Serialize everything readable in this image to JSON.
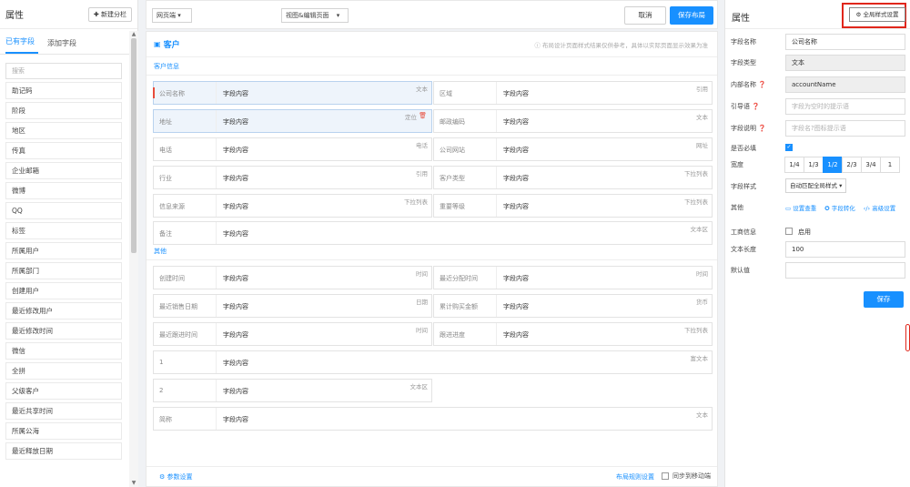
{
  "left": {
    "title": "属性",
    "new_group": "✚ 新建分栏",
    "tabs": [
      "已有字段",
      "添加字段"
    ],
    "search_placeholder": "搜索",
    "fields": [
      "助记码",
      "阶段",
      "地区",
      "传真",
      "企业邮箱",
      "微博",
      "QQ",
      "标签",
      "所属用户",
      "所属部门",
      "创建用户",
      "最近修改用户",
      "最近修改时间",
      "微信",
      "全拼",
      "父级客户",
      "最近共享时间",
      "所属公海",
      "最近释放日期"
    ]
  },
  "topbar": {
    "device": "网页端",
    "view": "视图&编辑页面",
    "cancel": "取消",
    "save_layout": "保存布局"
  },
  "canvas": {
    "title": "客户",
    "hint": "布局设计页面样式结果仅供参考，具体以实际页面显示效果为准",
    "sections": [
      {
        "title": "客户信息"
      },
      {
        "title": "其他"
      }
    ],
    "cells1": [
      {
        "label": "公司名称",
        "value": "字段内容",
        "type": "文本"
      },
      {
        "label": "区域",
        "value": "字段内容",
        "type": "引用"
      },
      {
        "label": "地址",
        "value": "字段内容",
        "type": "定位"
      },
      {
        "label": "邮政编码",
        "value": "字段内容",
        "type": "文本"
      },
      {
        "label": "电话",
        "value": "字段内容",
        "type": "电话"
      },
      {
        "label": "公司网站",
        "value": "字段内容",
        "type": "网址"
      },
      {
        "label": "行业",
        "value": "字段内容",
        "type": "引用"
      },
      {
        "label": "客户类型",
        "value": "字段内容",
        "type": "下拉列表"
      },
      {
        "label": "信息来源",
        "value": "字段内容",
        "type": "下拉列表"
      },
      {
        "label": "重要等级",
        "value": "字段内容",
        "type": "下拉列表"
      },
      {
        "label": "备注",
        "value": "字段内容",
        "type": "文本区"
      }
    ],
    "cells2": [
      {
        "label": "创建时间",
        "value": "字段内容",
        "type": "时间"
      },
      {
        "label": "最近分配时间",
        "value": "字段内容",
        "type": "时间"
      },
      {
        "label": "最近销售日期",
        "value": "字段内容",
        "type": "日期"
      },
      {
        "label": "累计购买金额",
        "value": "字段内容",
        "type": "货币"
      },
      {
        "label": "最近跟进时间",
        "value": "字段内容",
        "type": "时间"
      },
      {
        "label": "跟进进度",
        "value": "字段内容",
        "type": "下拉列表"
      },
      {
        "label": "1",
        "value": "字段内容",
        "type": "富文本"
      },
      {
        "label": "2",
        "value": "字段内容",
        "type": "文本区"
      },
      {
        "label": "简称",
        "value": "字段内容",
        "type": "文本"
      }
    ],
    "foot_left": "⚙ 参数设置",
    "foot_right": "布局规则设置",
    "foot_sync": "同步到移动端"
  },
  "right": {
    "title": "属性",
    "global_btn": "⚙ 全局样式设置",
    "rows": {
      "name_k": "字段名称",
      "name_v": "公司名称",
      "type_k": "字段类型",
      "type_v": "文本",
      "inner_k": "内部名称",
      "inner_v": "accountName",
      "guide_k": "引导语",
      "guide_ph": "字段为空时的提示语",
      "desc_k": "字段说明",
      "desc_ph": "字段名?图标提示语",
      "required_k": "是否必填",
      "width_k": "宽度",
      "style_k": "字段样式",
      "style_v": "自动匹配全局样式",
      "other_k": "其他",
      "biz_k": "工商信息",
      "biz_v": "启用",
      "len_k": "文本长度",
      "len_v": "100",
      "def_k": "默认值"
    },
    "width_opts": [
      "1/4",
      "1/3",
      "1/2",
      "2/3",
      "3/4",
      "1"
    ],
    "width_selected": "1/2",
    "links": [
      "▭ 设置查重",
      "✪ 字段转化",
      "‹/› 高级设置"
    ],
    "save": "保存"
  }
}
